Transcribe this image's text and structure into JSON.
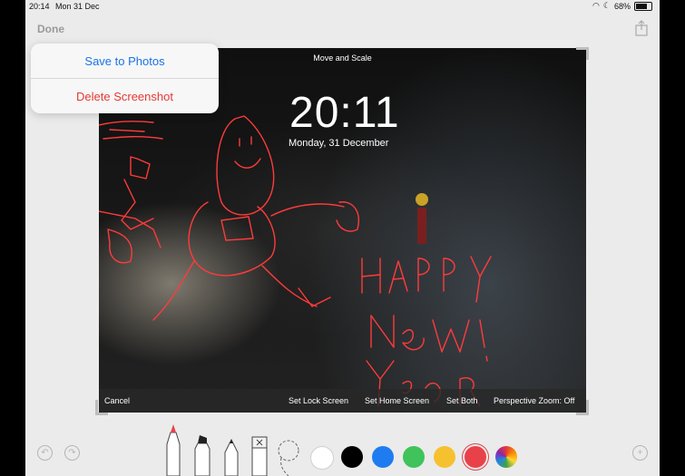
{
  "status": {
    "time": "20:14",
    "date": "Mon 31 Dec",
    "battery": "68%"
  },
  "toolbar": {
    "done": "Done"
  },
  "popover": {
    "save": "Save to Photos",
    "delete": "Delete Screenshot"
  },
  "screen": {
    "top_label": "Move and Scale",
    "clock": "20:11",
    "date": "Monday, 31 December",
    "actions": [
      "Cancel",
      "Set Lock Screen",
      "Set Home Screen",
      "Set Both",
      "Perspective Zoom: Off"
    ]
  },
  "markup": {
    "colors": [
      "#ffffff",
      "#000000",
      "#1e7cf0",
      "#3fc35a",
      "#f6c12e",
      "#e8414a"
    ],
    "selected_color": "#e8414a",
    "tools": [
      "pen-icon",
      "marker-icon",
      "pencil-icon",
      "eraser-icon",
      "lasso-icon"
    ]
  }
}
